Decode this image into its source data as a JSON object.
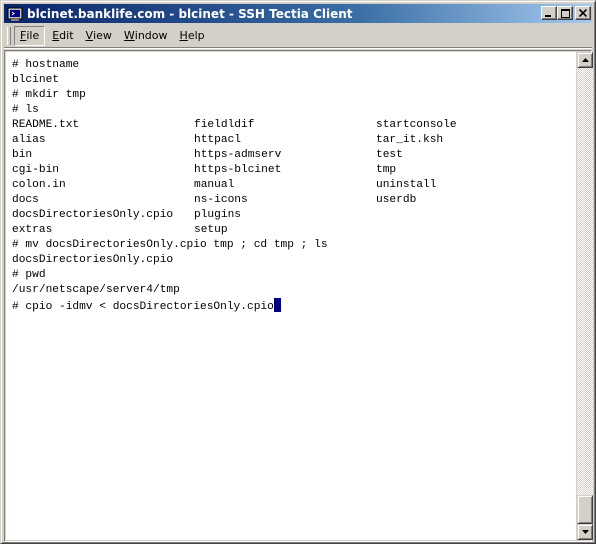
{
  "window": {
    "title": "blcinet.banklife.com - blcinet - SSH Tectia Client",
    "app_icon": "terminal-app-icon",
    "controls": {
      "minimize": "0",
      "maximize": "1",
      "close": "r"
    }
  },
  "menu": {
    "items": [
      {
        "label": "File",
        "accel": "F",
        "rest": "ile",
        "active": true
      },
      {
        "label": "Edit",
        "accel": "E",
        "rest": "dit",
        "active": false
      },
      {
        "label": "View",
        "accel": "V",
        "rest": "iew",
        "active": false
      },
      {
        "label": "Window",
        "accel": "W",
        "rest": "indow",
        "active": false
      },
      {
        "label": "Help",
        "accel": "H",
        "rest": "elp",
        "active": false
      }
    ]
  },
  "terminal": {
    "lines_before": [
      "# hostname",
      "blcinet",
      "# mkdir tmp",
      "# ls"
    ],
    "ls_rows": [
      [
        "README.txt",
        "fieldldif",
        "startconsole"
      ],
      [
        "alias",
        "httpacl",
        "tar_it.ksh"
      ],
      [
        "bin",
        "https-admserv",
        "test"
      ],
      [
        "cgi-bin",
        "https-blcinet",
        "tmp"
      ],
      [
        "colon.in",
        "manual",
        "uninstall"
      ],
      [
        "docs",
        "ns-icons",
        "userdb"
      ],
      [
        "docsDirectoriesOnly.cpio",
        "plugins",
        ""
      ],
      [
        "extras",
        "setup",
        ""
      ]
    ],
    "lines_after": [
      "# mv docsDirectoriesOnly.cpio tmp ; cd tmp ; ls",
      "docsDirectoriesOnly.cpio",
      "# pwd",
      "/usr/netscape/server4/tmp"
    ],
    "current_input": "# cpio -idmv < docsDirectoriesOnly.cpio"
  },
  "colors": {
    "titlebar_start": "#0a246a",
    "titlebar_end": "#a6caf0",
    "cursor": "#000080",
    "terminal_bg": "#ffffff"
  }
}
